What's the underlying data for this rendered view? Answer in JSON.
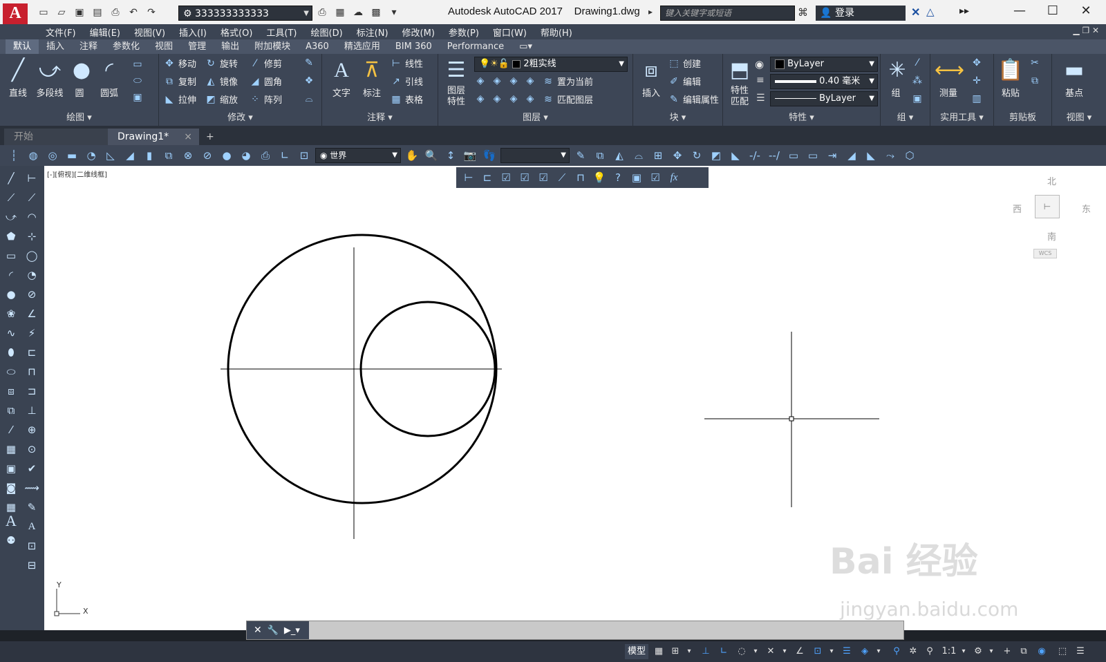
{
  "titlebar": {
    "logo": "A",
    "workspace": "333333333333",
    "app_title": "Autodesk AutoCAD 2017",
    "doc_title": "Drawing1.dwg",
    "search_placeholder": "键入关键字或短语",
    "login": "登录",
    "minimize": "—",
    "maximize": "☐",
    "close": "✕"
  },
  "menubar": [
    "文件(F)",
    "编辑(E)",
    "视图(V)",
    "插入(I)",
    "格式(O)",
    "工具(T)",
    "绘图(D)",
    "标注(N)",
    "修改(M)",
    "参数(P)",
    "窗口(W)",
    "帮助(H)"
  ],
  "ribbon_tabs": [
    "默认",
    "插入",
    "注释",
    "参数化",
    "视图",
    "管理",
    "输出",
    "附加模块",
    "A360",
    "精选应用",
    "BIM 360",
    "Performance"
  ],
  "ribbon": {
    "draw": {
      "label": "绘图",
      "line": "直线",
      "polyline": "多段线",
      "circle": "圆",
      "arc": "圆弧"
    },
    "modify": {
      "label": "修改",
      "move": "移动",
      "rotate": "旋转",
      "trim": "修剪",
      "copy": "复制",
      "mirror": "镜像",
      "fillet": "圆角",
      "stretch": "拉伸",
      "scale": "缩放",
      "array": "阵列"
    },
    "annotation": {
      "label": "注释",
      "text": "文字",
      "dimension": "标注",
      "linear": "线性",
      "leader": "引线",
      "table": "表格"
    },
    "layers": {
      "label": "图层",
      "layer_props": "图层\n特性",
      "layer_name": "2粗实线",
      "set_current": "置为当前",
      "match_layer": "匹配图层"
    },
    "block": {
      "label": "块",
      "insert": "插入",
      "create": "创建",
      "edit": "编辑",
      "edit_attr": "编辑属性"
    },
    "properties": {
      "label": "特性",
      "match": "特性\n匹配",
      "color": "ByLayer",
      "lineweight": "0.40 毫米",
      "linetype": "ByLayer"
    },
    "groups": {
      "label": "组",
      "group": "组"
    },
    "utilities": {
      "label": "实用工具",
      "measure": "测量"
    },
    "clipboard": {
      "label": "剪贴板",
      "paste": "粘贴"
    },
    "view": {
      "label": "视图",
      "base": "基点"
    }
  },
  "doc_tabs": {
    "start": "开始",
    "drawing": "Drawing1*",
    "close": "×",
    "add": "+"
  },
  "toolbar2": {
    "ucs_combo": "世界"
  },
  "viewport_label": "[-][俯视][二维线框]",
  "viewcube": {
    "north": "北",
    "south": "南",
    "east": "东",
    "west": "西",
    "wcs": "WCS"
  },
  "ucs_icon": {
    "x": "X",
    "y": "Y"
  },
  "statusbar": {
    "model": "模型",
    "scale": "1:1"
  },
  "watermark": {
    "main": "Bai 经验",
    "sub": "jingyan.baidu.com"
  }
}
